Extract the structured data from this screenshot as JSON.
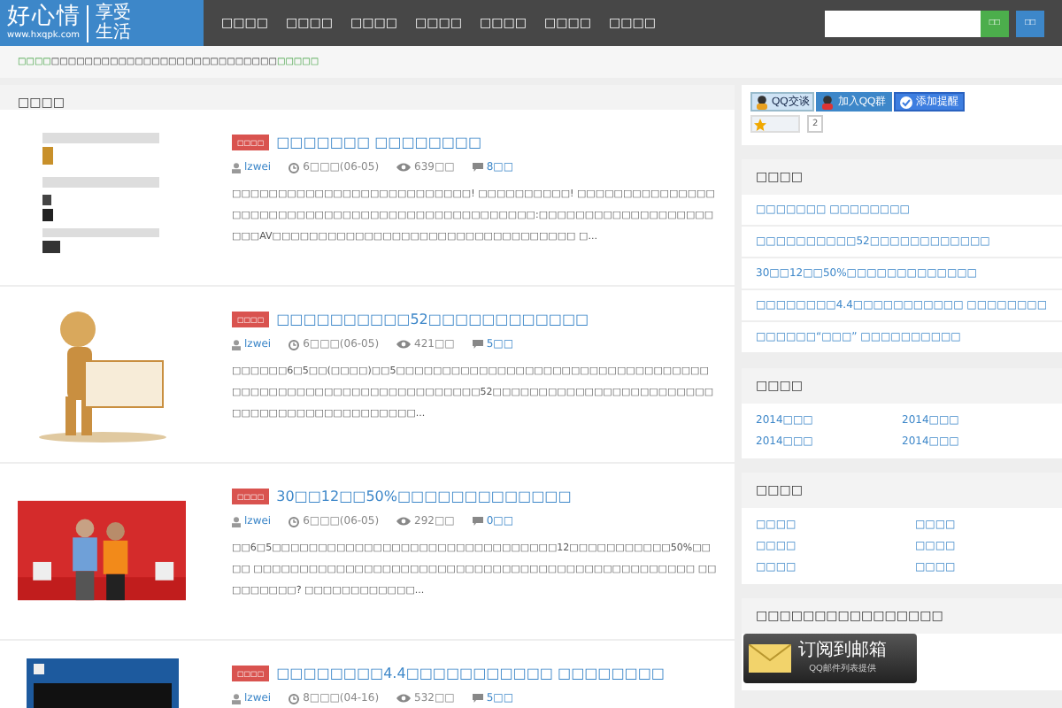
{
  "header": {
    "logo": {
      "name": "好心情",
      "url": "www.hxqpk.com",
      "slogan": "享受生活"
    },
    "nav": [
      "□□□□",
      "□□□□",
      "□□□□",
      "□□□□",
      "□□□□",
      "□□□□",
      "□□□□"
    ],
    "search": {
      "buttons": [
        "□□",
        "□□"
      ]
    }
  },
  "notice": [
    {
      "text": "□□□□",
      "highlight": true
    },
    {
      "text": "□□□□□□□□□□□□□□□□□□□□□□□□□□□",
      "highlight": false
    },
    {
      "text": "□□□□□",
      "highlight": true
    }
  ],
  "main": {
    "heading": "□□□□",
    "articles": [
      {
        "tag": "□□□□",
        "title": "□□□□□□□ □□□□□□□□",
        "author": "lzwei",
        "time": "6□□□(06-05)",
        "views": "639□□",
        "comments": "8□□",
        "excerpt": "□□□□□□□□□□□□□□□□□□□□□□□□□□! □□□□□□□□□□! □□□□□□□□□□□□□□□□□□□□□□□□□□□□□□□□□□□□□□□□□□□□□□□□:□□□□□□□□□□□□□□□□□□□ □□□AV□□□□□□□□□□□□□□□□□□□□□□□□□□□□□□□□□ □..."
      },
      {
        "tag": "□□□□",
        "title": "□□□□□□□□□□52□□□□□□□□□□□□",
        "author": "lzwei",
        "time": "6□□□(06-05)",
        "views": "421□□",
        "comments": "5□□",
        "excerpt": "□□□□□□6□5□□(□□□□)□□5□□□□□□□□□□□□□□□□□□□□□□□□□□□□□□□□□□□□□□□□□□□□□□□□□□□□□□□□□□□□□52□□□□□□□□□□□□□□□□□□□□□□□□□□□□□□□□□□□□□□□□□□□□..."
      },
      {
        "tag": "□□□□",
        "title": "30□□12□□50%□□□□□□□□□□□□□",
        "author": "lzwei",
        "time": "6□□□(06-05)",
        "views": "292□□",
        "comments": "0□□",
        "excerpt": "□□6□5□□□□□□□□□□□□□□□□□□□□□□□□□□□□□□□12□□□□□□□□□□□50%□□□□ □□□□□□□□□□□□□□□□□□□□□□□□□□□□□□□□□□□□□□□□□□□□□□□□ □□□□□□□□□? □□□□□□□□□□□□..."
      },
      {
        "tag": "□□□□",
        "title": "□□□□□□□□4.4□□□□□□□□□□□ □□□□□□□□",
        "author": "lzwei",
        "time": "8□□□(04-16)",
        "views": "532□□",
        "comments": "5□□"
      }
    ]
  },
  "sidebar": {
    "social": [
      "QQ交谈",
      "加入QQ群",
      "添加提醒"
    ],
    "star_count": "2",
    "recent": {
      "title": "□□□□",
      "items": [
        "□□□□□□□ □□□□□□□□",
        "□□□□□□□□□□52□□□□□□□□□□□□",
        "30□□12□□50%□□□□□□□□□□□□□",
        "□□□□□□□□4.4□□□□□□□□□□□ □□□□□□□□",
        "□□□□□□“□□□” □□□□□□□□□□"
      ]
    },
    "archive": {
      "title": "□□□□",
      "items": [
        "2014□□□",
        "2014□□□",
        "2014□□□",
        "2014□□□"
      ]
    },
    "categories": {
      "title": "□□□□",
      "items": [
        "□□□□",
        "□□□□",
        "□□□□",
        "□□□□",
        "□□□□",
        "□□□□"
      ]
    },
    "subscribe": {
      "title": "□□□□□□□□□□□□□□□□",
      "button": "订阅到邮箱",
      "note": "QQ邮件列表提供"
    }
  }
}
